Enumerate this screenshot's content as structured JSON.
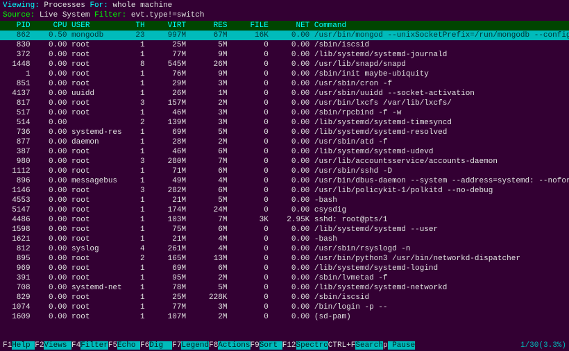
{
  "header": {
    "viewing_label": "Viewing:",
    "viewing_value": "Processes",
    "for_label": "For:",
    "for_value": "whole machine",
    "source_label": "Source:",
    "source_value": "Live System",
    "filter_label": "Filter:",
    "filter_value": "evt.type!=switch"
  },
  "columns": [
    "PID",
    "CPU",
    "USER",
    "TH",
    "VIRT",
    "RES",
    "FILE",
    "NET",
    "Command"
  ],
  "highlighted": {
    "pid": "862",
    "cpu": "0.50",
    "user": "mongodb",
    "th": "23",
    "virt": "997M",
    "res": "67M",
    "file": "16K",
    "net": "0.00",
    "cmd": "/usr/bin/mongod --unixSocketPrefix=/run/mongodb --config /etc/mongodb.conf"
  },
  "processes": [
    {
      "pid": "830",
      "cpu": "0.00",
      "user": "root",
      "th": "1",
      "virt": "25M",
      "res": "5M",
      "file": "0",
      "net": "0.00",
      "cmd": "/sbin/iscsid"
    },
    {
      "pid": "372",
      "cpu": "0.00",
      "user": "root",
      "th": "1",
      "virt": "77M",
      "res": "9M",
      "file": "0",
      "net": "0.00",
      "cmd": "/lib/systemd/systemd-journald"
    },
    {
      "pid": "1448",
      "cpu": "0.00",
      "user": "root",
      "th": "8",
      "virt": "545M",
      "res": "26M",
      "file": "0",
      "net": "0.00",
      "cmd": "/usr/lib/snapd/snapd"
    },
    {
      "pid": "1",
      "cpu": "0.00",
      "user": "root",
      "th": "1",
      "virt": "76M",
      "res": "9M",
      "file": "0",
      "net": "0.00",
      "cmd": "/sbin/init maybe-ubiquity"
    },
    {
      "pid": "851",
      "cpu": "0.00",
      "user": "root",
      "th": "1",
      "virt": "29M",
      "res": "3M",
      "file": "0",
      "net": "0.00",
      "cmd": "/usr/sbin/cron -f"
    },
    {
      "pid": "4137",
      "cpu": "0.00",
      "user": "uuidd",
      "th": "1",
      "virt": "26M",
      "res": "1M",
      "file": "0",
      "net": "0.00",
      "cmd": "/usr/sbin/uuidd --socket-activation"
    },
    {
      "pid": "817",
      "cpu": "0.00",
      "user": "root",
      "th": "3",
      "virt": "157M",
      "res": "2M",
      "file": "0",
      "net": "0.00",
      "cmd": "/usr/bin/lxcfs /var/lib/lxcfs/"
    },
    {
      "pid": "517",
      "cpu": "0.00",
      "user": "root",
      "th": "1",
      "virt": "46M",
      "res": "3M",
      "file": "0",
      "net": "0.00",
      "cmd": "/sbin/rpcbind -f -w"
    },
    {
      "pid": "514",
      "cpu": "0.00",
      "user": "",
      "th": "2",
      "virt": "139M",
      "res": "3M",
      "file": "0",
      "net": "0.00",
      "cmd": "/lib/systemd/systemd-timesyncd"
    },
    {
      "pid": "736",
      "cpu": "0.00",
      "user": "systemd-res",
      "th": "1",
      "virt": "69M",
      "res": "5M",
      "file": "0",
      "net": "0.00",
      "cmd": "/lib/systemd/systemd-resolved"
    },
    {
      "pid": "877",
      "cpu": "0.00",
      "user": "daemon",
      "th": "1",
      "virt": "28M",
      "res": "2M",
      "file": "0",
      "net": "0.00",
      "cmd": "/usr/sbin/atd -f"
    },
    {
      "pid": "387",
      "cpu": "0.00",
      "user": "root",
      "th": "1",
      "virt": "46M",
      "res": "6M",
      "file": "0",
      "net": "0.00",
      "cmd": "/lib/systemd/systemd-udevd"
    },
    {
      "pid": "980",
      "cpu": "0.00",
      "user": "root",
      "th": "3",
      "virt": "280M",
      "res": "7M",
      "file": "0",
      "net": "0.00",
      "cmd": "/usr/lib/accountsservice/accounts-daemon"
    },
    {
      "pid": "1112",
      "cpu": "0.00",
      "user": "root",
      "th": "1",
      "virt": "71M",
      "res": "6M",
      "file": "0",
      "net": "0.00",
      "cmd": "/usr/sbin/sshd -D"
    },
    {
      "pid": "896",
      "cpu": "0.00",
      "user": "messagebus",
      "th": "1",
      "virt": "49M",
      "res": "4M",
      "file": "0",
      "net": "0.00",
      "cmd": "/usr/bin/dbus-daemon --system --address=systemd: --nofork --nopidfile --systemd-activ"
    },
    {
      "pid": "1146",
      "cpu": "0.00",
      "user": "root",
      "th": "3",
      "virt": "282M",
      "res": "6M",
      "file": "0",
      "net": "0.00",
      "cmd": "/usr/lib/policykit-1/polkitd --no-debug"
    },
    {
      "pid": "4553",
      "cpu": "0.00",
      "user": "root",
      "th": "1",
      "virt": "21M",
      "res": "5M",
      "file": "0",
      "net": "0.00",
      "cmd": "-bash"
    },
    {
      "pid": "5147",
      "cpu": "0.00",
      "user": "root",
      "th": "1",
      "virt": "174M",
      "res": "24M",
      "file": "0",
      "net": "0.00",
      "cmd": "csysdig"
    },
    {
      "pid": "4486",
      "cpu": "0.00",
      "user": "root",
      "th": "1",
      "virt": "103M",
      "res": "7M",
      "file": "3K",
      "net": "2.95K",
      "cmd": "sshd: root@pts/1"
    },
    {
      "pid": "1598",
      "cpu": "0.00",
      "user": "root",
      "th": "1",
      "virt": "75M",
      "res": "6M",
      "file": "0",
      "net": "0.00",
      "cmd": "/lib/systemd/systemd --user"
    },
    {
      "pid": "1621",
      "cpu": "0.00",
      "user": "root",
      "th": "1",
      "virt": "21M",
      "res": "4M",
      "file": "0",
      "net": "0.00",
      "cmd": "-bash"
    },
    {
      "pid": "812",
      "cpu": "0.00",
      "user": "syslog",
      "th": "4",
      "virt": "261M",
      "res": "4M",
      "file": "0",
      "net": "0.00",
      "cmd": "/usr/sbin/rsyslogd -n"
    },
    {
      "pid": "895",
      "cpu": "0.00",
      "user": "root",
      "th": "2",
      "virt": "165M",
      "res": "13M",
      "file": "0",
      "net": "0.00",
      "cmd": "/usr/bin/python3 /usr/bin/networkd-dispatcher"
    },
    {
      "pid": "969",
      "cpu": "0.00",
      "user": "root",
      "th": "1",
      "virt": "69M",
      "res": "6M",
      "file": "0",
      "net": "0.00",
      "cmd": "/lib/systemd/systemd-logind"
    },
    {
      "pid": "391",
      "cpu": "0.00",
      "user": "root",
      "th": "1",
      "virt": "95M",
      "res": "2M",
      "file": "0",
      "net": "0.00",
      "cmd": "/sbin/lvmetad -f"
    },
    {
      "pid": "708",
      "cpu": "0.00",
      "user": "systemd-net",
      "th": "1",
      "virt": "78M",
      "res": "5M",
      "file": "0",
      "net": "0.00",
      "cmd": "/lib/systemd/systemd-networkd"
    },
    {
      "pid": "829",
      "cpu": "0.00",
      "user": "root",
      "th": "1",
      "virt": "25M",
      "res": "228K",
      "file": "0",
      "net": "0.00",
      "cmd": "/sbin/iscsid"
    },
    {
      "pid": "1074",
      "cpu": "0.00",
      "user": "root",
      "th": "1",
      "virt": "77M",
      "res": "3M",
      "file": "0",
      "net": "0.00",
      "cmd": "/bin/login -p --"
    },
    {
      "pid": "1609",
      "cpu": "0.00",
      "user": "root",
      "th": "1",
      "virt": "107M",
      "res": "2M",
      "file": "0",
      "net": "0.00",
      "cmd": "(sd-pam)"
    }
  ],
  "footer": {
    "keys": [
      {
        "k": "F1",
        "l": "Help "
      },
      {
        "k": "F2",
        "l": "Views "
      },
      {
        "k": "F4",
        "l": "Filter"
      },
      {
        "k": "F5",
        "l": "Echo "
      },
      {
        "k": "F6",
        "l": "Dig  "
      },
      {
        "k": "F7",
        "l": "Legend"
      },
      {
        "k": "F8",
        "l": "Actions"
      },
      {
        "k": "F9",
        "l": "Sort "
      },
      {
        "k": "F12",
        "l": "Spectro"
      },
      {
        "k": "CTRL+F",
        "l": "Search"
      },
      {
        "k": "p",
        "l": " Pause"
      }
    ],
    "status": "1/30(3.3%)"
  }
}
